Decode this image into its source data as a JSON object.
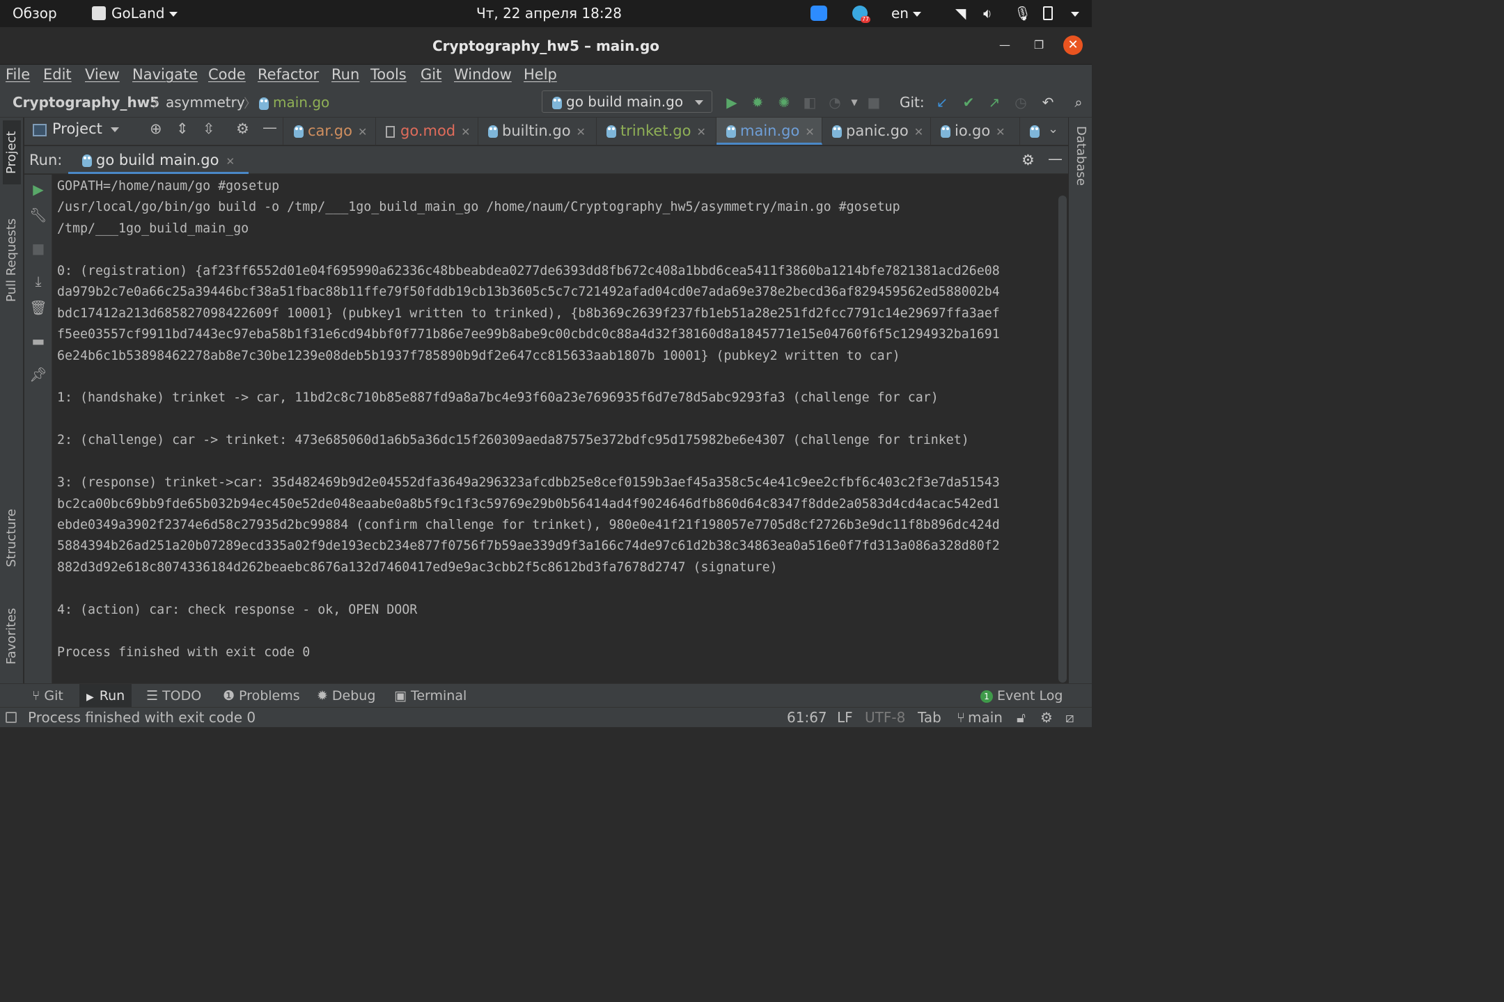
{
  "system_bar": {
    "activities": "Обзор",
    "app_name": "GoLand",
    "clock": "Чт, 22 апреля  18:28",
    "keyboard_layout": "en",
    "telegram_badge": "77"
  },
  "window": {
    "title": "Cryptography_hw5 – main.go"
  },
  "menu": [
    "File",
    "Edit",
    "View",
    "Navigate",
    "Code",
    "Refactor",
    "Run",
    "Tools",
    "Git",
    "Window",
    "Help"
  ],
  "breadcrumb": {
    "project": "Cryptography_hw5",
    "folder": "asymmetry",
    "file": "main.go"
  },
  "toolbar": {
    "run_config": "go build main.go",
    "git_label": "Git:"
  },
  "project_panel": {
    "label": "Project"
  },
  "editor_tabs": [
    {
      "label": "car.go",
      "color": "#d08f5f"
    },
    {
      "label": "go.mod",
      "color": "#e06c5b"
    },
    {
      "label": "builtin.go",
      "color": "#c8c8c8"
    },
    {
      "label": "trinket.go",
      "color": "#8fb056"
    },
    {
      "label": "main.go",
      "color": "#6f9fd8"
    },
    {
      "label": "panic.go",
      "color": "#c8c8c8"
    },
    {
      "label": "io.go",
      "color": "#c8c8c8"
    }
  ],
  "run_window": {
    "label": "Run:",
    "tab": "go build main.go"
  },
  "console_lines": [
    "GOPATH=/home/naum/go #gosetup",
    "/usr/local/go/bin/go build -o /tmp/___1go_build_main_go /home/naum/Cryptography_hw5/asymmetry/main.go #gosetup",
    "/tmp/___1go_build_main_go",
    "",
    "0: (registration) {af23ff6552d01e04f695990a62336c48bbeabdea0277de6393dd8fb672c408a1bbd6cea5411f3860ba1214bfe7821381acd26e08",
    "da979b2c7e0a66c25a39446bcf38a51fbac88b11ffe79f50fddb19cb13b3605c5c7c721492afad04cd0e7ada69e378e2becd36af829459562ed588002b4",
    "bdc17412a213d685827098422609f 10001} (pubkey1 written to trinked), {b8b369c2639f237fb1eb51a28e251fd2fcc7791c14e29697ffa3aef",
    "f5ee03557cf9911bd7443ec97eba58b1f31e6cd94bbf0f771b86e7ee99b8abe9c00cbdc0c88a4d32f38160d8a1845771e15e04760f6f5c1294932ba1691",
    "6e24b6c1b53898462278ab8e7c30be1239e08deb5b1937f785890b9df2e647cc815633aab1807b 10001} (pubkey2 written to car)",
    "",
    "1: (handshake) trinket -> car, 11bd2c8c710b85e887fd9a8a7bc4e93f60a23e7696935f6d7e78d5abc9293fa3 (challenge for car)",
    "",
    "2: (challenge) car -> trinket: 473e685060d1a6b5a36dc15f260309aeda87575e372bdfc95d175982be6e4307 (challenge for trinket)",
    "",
    "3: (response) trinket->car: 35d482469b9d2e04552dfa3649a296323afcdbb25e8cef0159b3aef45a358c5c4e41c9ee2cfbf6c403c2f3e7da51543",
    "bc2ca00bc69bb9fde65b032b94ec450e52de048eaabe0a8b5f9c1f3c59769e29b0b56414ad4f9024646dfb860d64c8347f8dde2a0583d4cd4acac542ed1",
    "ebde0349a3902f2374e6d58c27935d2bc99884 (confirm challenge for trinket), 980e0e41f21f198057e7705d8cf2726b3e9dc11f8b896dc424d",
    "5884394b26ad251a20b07289ecd335a02f9de193ecb234e877f0756f7b59ae339d9f3a166c74de97c61d2b38c34863ea0a516e0f7fd313a086a328d80f2",
    "882d3d92e618c8074336184d262beaebc8676a132d7460417ed9e9ac3cbb2f5c8612bd3fa7678d2747 (signature)",
    "",
    "4: (action) car: check response - ok, OPEN DOOR",
    "",
    "Process finished with exit code 0"
  ],
  "left_stripe": {
    "project": "Project",
    "pull_requests": "Pull Requests",
    "structure": "Structure",
    "favorites": "Favorites"
  },
  "right_stripe": {
    "database": "Database"
  },
  "bottom_tools": {
    "git": "Git",
    "run": "Run",
    "todo": "TODO",
    "problems": "Problems",
    "debug": "Debug",
    "terminal": "Terminal",
    "event_log": "Event Log",
    "event_count": "1"
  },
  "status_bar": {
    "message": "Process finished with exit code 0",
    "position": "61:67",
    "line_sep": "LF",
    "encoding": "UTF-8",
    "indent": "Tab",
    "branch": "main"
  }
}
